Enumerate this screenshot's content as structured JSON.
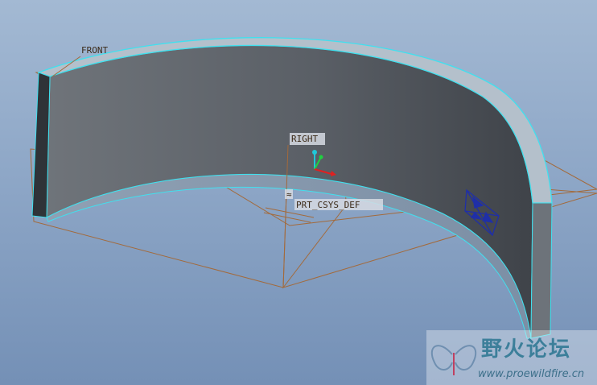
{
  "datums": {
    "front": "FRONT",
    "right": "RIGHT",
    "csys": "PRT_CSYS_DEF"
  },
  "watermark": {
    "title": "野火论坛",
    "url": "www.proewildfire.cn"
  },
  "colors": {
    "background_top": "#a3b9d3",
    "background_bottom": "#7490b6",
    "part_face": "#5c6168",
    "part_edge": "#40e0ee",
    "part_top_surface": "#b4c0cb",
    "datum_plane": "#a36a3b",
    "axis_x": "#e02020",
    "axis_y": "#20d040",
    "axis_z": "#20c8d8",
    "view_cube": "#1f2fa8"
  },
  "icons": {
    "csys_triad": "coordinate-system-icon",
    "view_orientation": "view-orientation-icon",
    "watermark_logo": "butterfly-logo-icon"
  }
}
